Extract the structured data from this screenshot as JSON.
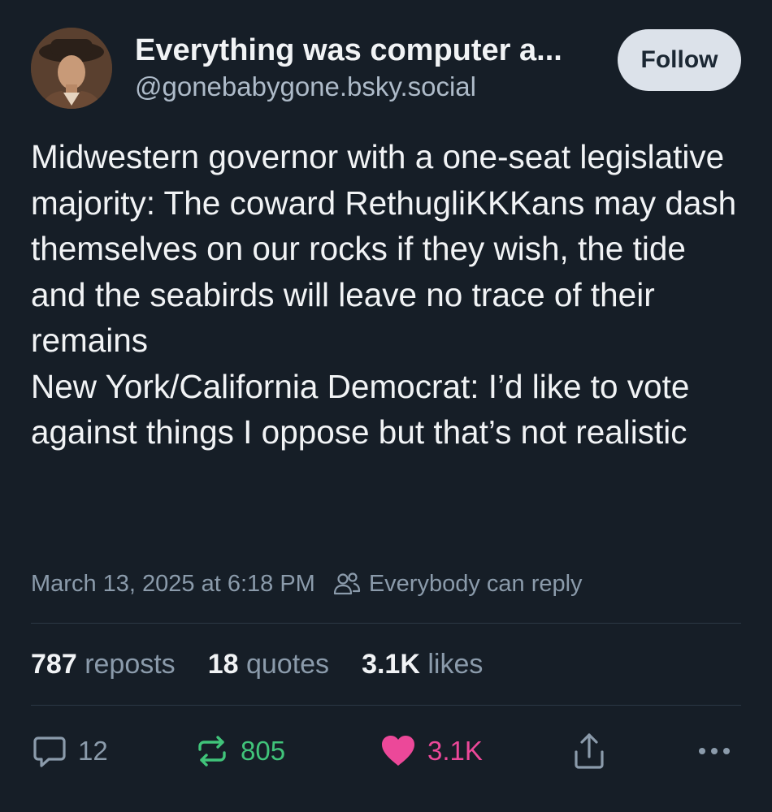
{
  "author": {
    "display_name": "Everything was computer a...",
    "handle": "@gonebabygone.bsky.social",
    "avatar_icon": "user-avatar"
  },
  "follow_label": "Follow",
  "post": {
    "paragraphs": [
      "Midwestern governor with a one-seat legislative majority: The coward RethugliKKKans may dash themselves on our rocks if they wish, the tide and the seabirds will leave no trace of their remains",
      "New York/California Democrat: I’d like to vote against things I oppose but that’s not realistic"
    ]
  },
  "meta": {
    "timestamp": "March 13, 2025 at 6:18 PM",
    "reply_setting": "Everybody can reply",
    "reply_setting_icon": "people-icon"
  },
  "stats": {
    "reposts_count": "787",
    "reposts_label": "reposts",
    "quotes_count": "18",
    "quotes_label": "quotes",
    "likes_count": "3.1K",
    "likes_label": "likes"
  },
  "actions": {
    "reply_count": "12",
    "repost_count": "805",
    "like_count": "3.1K"
  },
  "colors": {
    "background": "#161e27",
    "text": "#f1f3f5",
    "muted": "#8b9bab",
    "repost_active": "#40c47a",
    "like_active": "#ec4899",
    "follow_bg": "#dce2ea"
  }
}
